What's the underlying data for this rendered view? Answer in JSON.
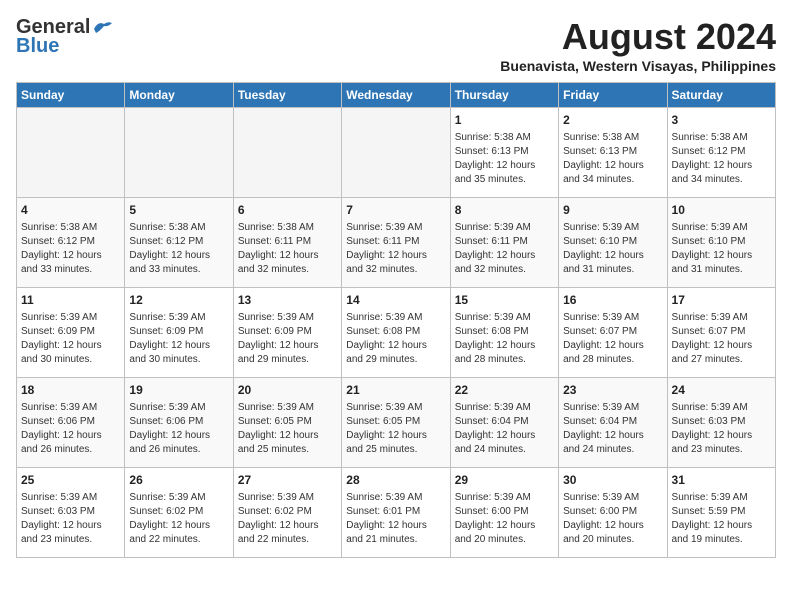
{
  "header": {
    "logo_line1": "General",
    "logo_line2": "Blue",
    "month_year": "August 2024",
    "location": "Buenavista, Western Visayas, Philippines"
  },
  "days_of_week": [
    "Sunday",
    "Monday",
    "Tuesday",
    "Wednesday",
    "Thursday",
    "Friday",
    "Saturday"
  ],
  "weeks": [
    [
      {
        "day": "",
        "info": ""
      },
      {
        "day": "",
        "info": ""
      },
      {
        "day": "",
        "info": ""
      },
      {
        "day": "",
        "info": ""
      },
      {
        "day": "1",
        "info": "Sunrise: 5:38 AM\nSunset: 6:13 PM\nDaylight: 12 hours\nand 35 minutes."
      },
      {
        "day": "2",
        "info": "Sunrise: 5:38 AM\nSunset: 6:13 PM\nDaylight: 12 hours\nand 34 minutes."
      },
      {
        "day": "3",
        "info": "Sunrise: 5:38 AM\nSunset: 6:12 PM\nDaylight: 12 hours\nand 34 minutes."
      }
    ],
    [
      {
        "day": "4",
        "info": "Sunrise: 5:38 AM\nSunset: 6:12 PM\nDaylight: 12 hours\nand 33 minutes."
      },
      {
        "day": "5",
        "info": "Sunrise: 5:38 AM\nSunset: 6:12 PM\nDaylight: 12 hours\nand 33 minutes."
      },
      {
        "day": "6",
        "info": "Sunrise: 5:38 AM\nSunset: 6:11 PM\nDaylight: 12 hours\nand 32 minutes."
      },
      {
        "day": "7",
        "info": "Sunrise: 5:39 AM\nSunset: 6:11 PM\nDaylight: 12 hours\nand 32 minutes."
      },
      {
        "day": "8",
        "info": "Sunrise: 5:39 AM\nSunset: 6:11 PM\nDaylight: 12 hours\nand 32 minutes."
      },
      {
        "day": "9",
        "info": "Sunrise: 5:39 AM\nSunset: 6:10 PM\nDaylight: 12 hours\nand 31 minutes."
      },
      {
        "day": "10",
        "info": "Sunrise: 5:39 AM\nSunset: 6:10 PM\nDaylight: 12 hours\nand 31 minutes."
      }
    ],
    [
      {
        "day": "11",
        "info": "Sunrise: 5:39 AM\nSunset: 6:09 PM\nDaylight: 12 hours\nand 30 minutes."
      },
      {
        "day": "12",
        "info": "Sunrise: 5:39 AM\nSunset: 6:09 PM\nDaylight: 12 hours\nand 30 minutes."
      },
      {
        "day": "13",
        "info": "Sunrise: 5:39 AM\nSunset: 6:09 PM\nDaylight: 12 hours\nand 29 minutes."
      },
      {
        "day": "14",
        "info": "Sunrise: 5:39 AM\nSunset: 6:08 PM\nDaylight: 12 hours\nand 29 minutes."
      },
      {
        "day": "15",
        "info": "Sunrise: 5:39 AM\nSunset: 6:08 PM\nDaylight: 12 hours\nand 28 minutes."
      },
      {
        "day": "16",
        "info": "Sunrise: 5:39 AM\nSunset: 6:07 PM\nDaylight: 12 hours\nand 28 minutes."
      },
      {
        "day": "17",
        "info": "Sunrise: 5:39 AM\nSunset: 6:07 PM\nDaylight: 12 hours\nand 27 minutes."
      }
    ],
    [
      {
        "day": "18",
        "info": "Sunrise: 5:39 AM\nSunset: 6:06 PM\nDaylight: 12 hours\nand 26 minutes."
      },
      {
        "day": "19",
        "info": "Sunrise: 5:39 AM\nSunset: 6:06 PM\nDaylight: 12 hours\nand 26 minutes."
      },
      {
        "day": "20",
        "info": "Sunrise: 5:39 AM\nSunset: 6:05 PM\nDaylight: 12 hours\nand 25 minutes."
      },
      {
        "day": "21",
        "info": "Sunrise: 5:39 AM\nSunset: 6:05 PM\nDaylight: 12 hours\nand 25 minutes."
      },
      {
        "day": "22",
        "info": "Sunrise: 5:39 AM\nSunset: 6:04 PM\nDaylight: 12 hours\nand 24 minutes."
      },
      {
        "day": "23",
        "info": "Sunrise: 5:39 AM\nSunset: 6:04 PM\nDaylight: 12 hours\nand 24 minutes."
      },
      {
        "day": "24",
        "info": "Sunrise: 5:39 AM\nSunset: 6:03 PM\nDaylight: 12 hours\nand 23 minutes."
      }
    ],
    [
      {
        "day": "25",
        "info": "Sunrise: 5:39 AM\nSunset: 6:03 PM\nDaylight: 12 hours\nand 23 minutes."
      },
      {
        "day": "26",
        "info": "Sunrise: 5:39 AM\nSunset: 6:02 PM\nDaylight: 12 hours\nand 22 minutes."
      },
      {
        "day": "27",
        "info": "Sunrise: 5:39 AM\nSunset: 6:02 PM\nDaylight: 12 hours\nand 22 minutes."
      },
      {
        "day": "28",
        "info": "Sunrise: 5:39 AM\nSunset: 6:01 PM\nDaylight: 12 hours\nand 21 minutes."
      },
      {
        "day": "29",
        "info": "Sunrise: 5:39 AM\nSunset: 6:00 PM\nDaylight: 12 hours\nand 20 minutes."
      },
      {
        "day": "30",
        "info": "Sunrise: 5:39 AM\nSunset: 6:00 PM\nDaylight: 12 hours\nand 20 minutes."
      },
      {
        "day": "31",
        "info": "Sunrise: 5:39 AM\nSunset: 5:59 PM\nDaylight: 12 hours\nand 19 minutes."
      }
    ]
  ]
}
